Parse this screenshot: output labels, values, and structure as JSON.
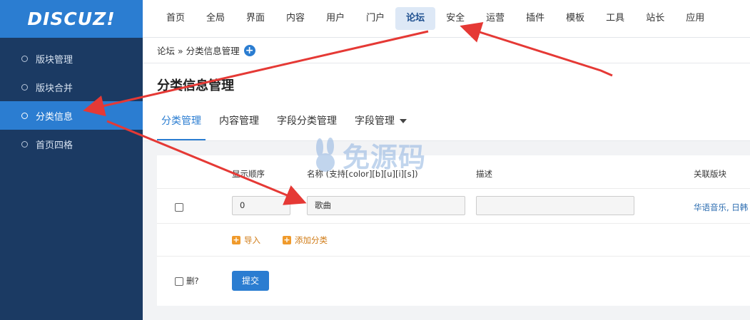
{
  "logo": "DISCUZ!",
  "sidebar": {
    "items": [
      {
        "label": "版块管理"
      },
      {
        "label": "版块合并"
      },
      {
        "label": "分类信息"
      },
      {
        "label": "首页四格"
      }
    ]
  },
  "topnav": {
    "items": [
      {
        "label": "首页"
      },
      {
        "label": "全局"
      },
      {
        "label": "界面"
      },
      {
        "label": "内容"
      },
      {
        "label": "用户"
      },
      {
        "label": "门户"
      },
      {
        "label": "论坛"
      },
      {
        "label": "安全"
      },
      {
        "label": "运营"
      },
      {
        "label": "插件"
      },
      {
        "label": "模板"
      },
      {
        "label": "工具"
      },
      {
        "label": "站长"
      },
      {
        "label": "应用"
      }
    ]
  },
  "breadcrumb": "论坛 » 分类信息管理",
  "page_title": "分类信息管理",
  "tabs": [
    {
      "label": "分类管理"
    },
    {
      "label": "内容管理"
    },
    {
      "label": "字段分类管理"
    },
    {
      "label": "字段管理"
    }
  ],
  "table": {
    "headers": {
      "order": "显示顺序",
      "name": "名称 (支持[color][b][u][i][s])",
      "desc": "描述",
      "forums": "关联版块"
    },
    "row": {
      "order": "0",
      "name": "歌曲",
      "desc": "",
      "forums": "华语音乐, 日韩"
    }
  },
  "actions": {
    "import": "导入",
    "add_category": "添加分类"
  },
  "delete_label": "删?",
  "submit_label": "提交",
  "watermark": "免源码",
  "colors": {
    "sidebar_bg": "#1b3a63",
    "accent": "#2b7dd1",
    "arrow": "#e53935"
  }
}
